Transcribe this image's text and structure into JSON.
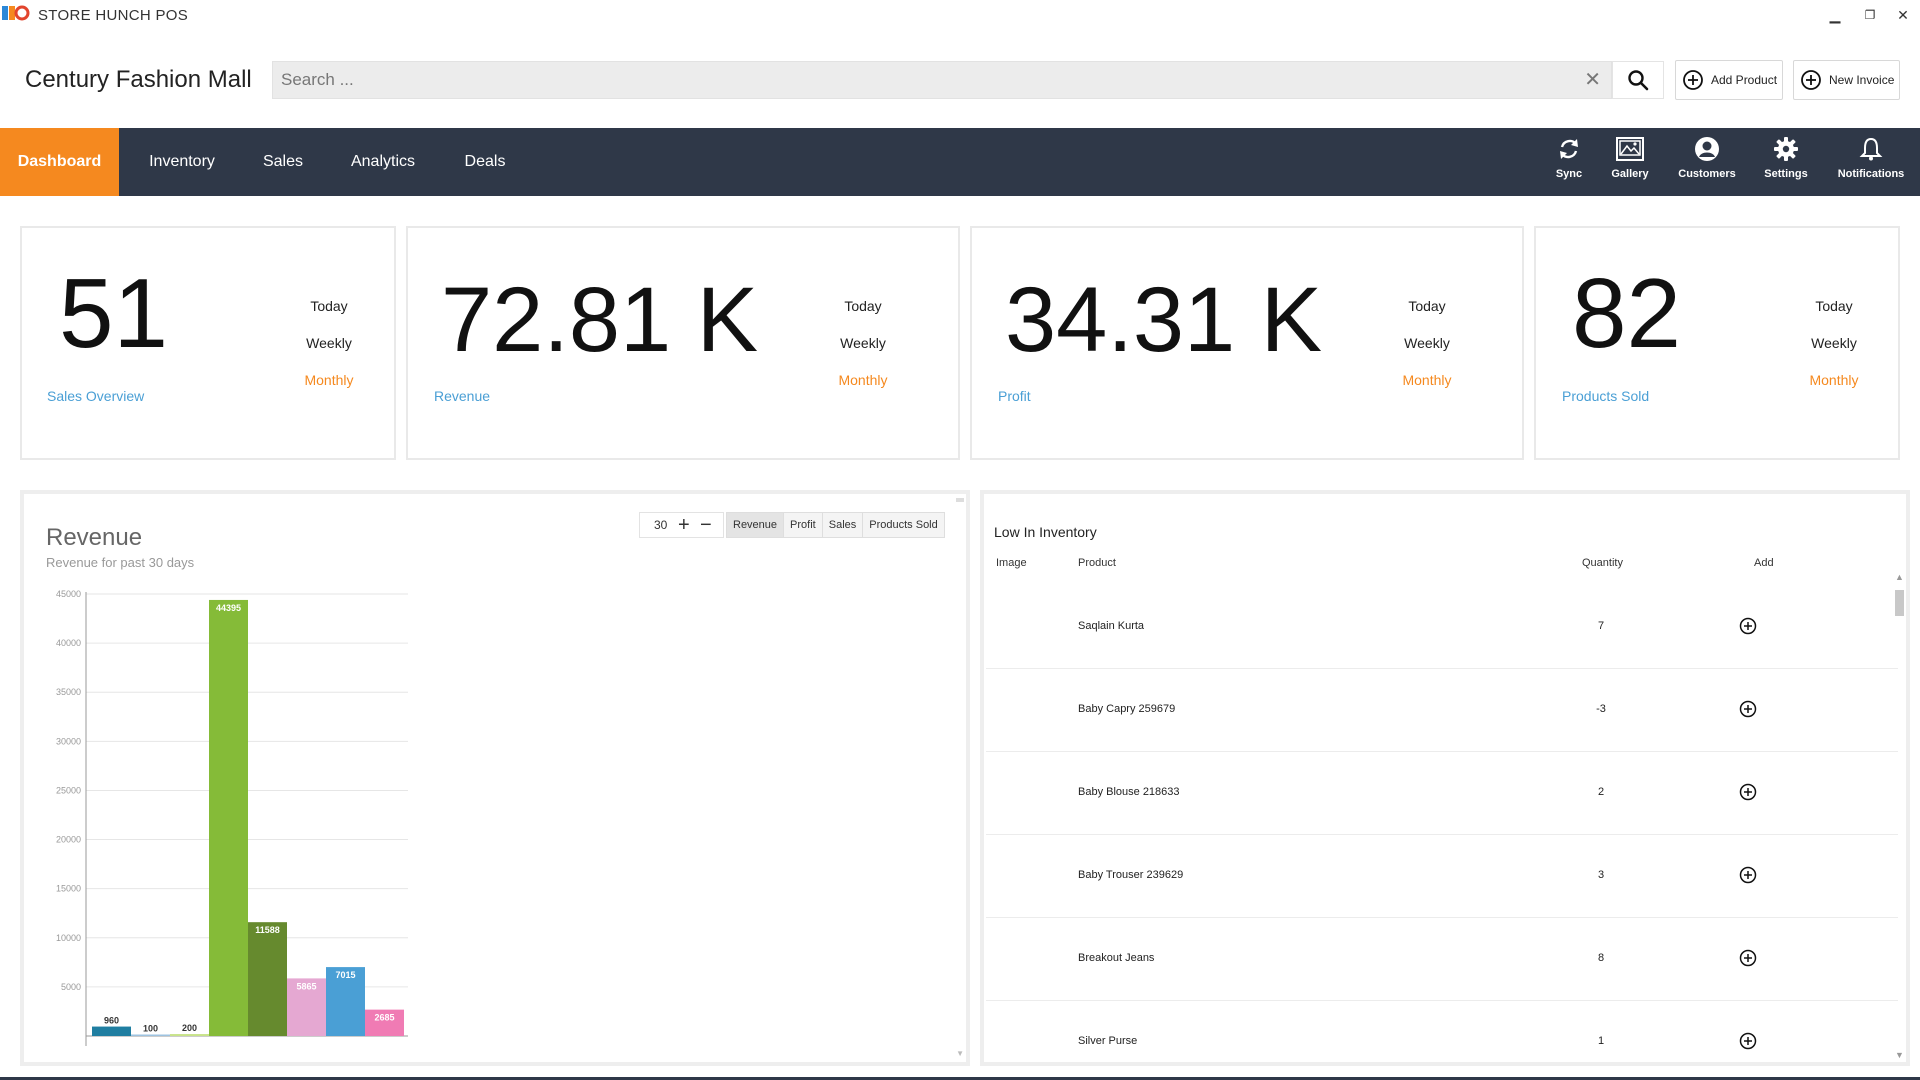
{
  "app": {
    "title": "STORE HUNCH POS"
  },
  "window_controls": {
    "minimize": "▁",
    "restore": "❐",
    "close": "✕"
  },
  "header": {
    "store_name": "Century Fashion Mall",
    "search_placeholder": "Search ...",
    "add_product": "Add Product",
    "new_invoice": "New Invoice"
  },
  "nav": {
    "tabs": [
      "Dashboard",
      "Inventory",
      "Sales",
      "Analytics",
      "Deals"
    ],
    "active": "Dashboard",
    "icons": [
      {
        "label": "Sync",
        "icon": "sync-icon"
      },
      {
        "label": "Gallery",
        "icon": "gallery-icon"
      },
      {
        "label": "Customers",
        "icon": "customers-icon"
      },
      {
        "label": "Settings",
        "icon": "gear-icon"
      },
      {
        "label": "Notifications",
        "icon": "bell-icon"
      }
    ]
  },
  "stats": [
    {
      "value": "51",
      "label": "Sales Overview",
      "periods": [
        "Today",
        "Weekly",
        "Monthly"
      ],
      "selected": "Monthly"
    },
    {
      "value": "72.81 K",
      "label": "Revenue",
      "periods": [
        "Today",
        "Weekly",
        "Monthly"
      ],
      "selected": "Monthly"
    },
    {
      "value": "34.31 K",
      "label": "Profit",
      "periods": [
        "Today",
        "Weekly",
        "Monthly"
      ],
      "selected": "Monthly"
    },
    {
      "value": "82",
      "label": "Products Sold",
      "periods": [
        "Today",
        "Weekly",
        "Monthly"
      ],
      "selected": "Monthly"
    }
  ],
  "revenue_panel": {
    "title": "Revenue",
    "subtitle": "Revenue for past 30 days",
    "days": "30",
    "metrics": [
      "Revenue",
      "Profit",
      "Sales",
      "Products Sold"
    ],
    "selected_metric": "Revenue"
  },
  "chart_data": {
    "type": "bar",
    "title": "Revenue",
    "subtitle": "Revenue for past 30 days",
    "values": [
      960,
      100,
      200,
      44395,
      11588,
      5865,
      7015,
      2685
    ],
    "colors": [
      "#1f7ea1",
      "#9ec3e0",
      "#c8e38a",
      "#85bb38",
      "#668a2e",
      "#e5a8d2",
      "#4a9fd5",
      "#f07bb4"
    ],
    "ylim": [
      0,
      45000
    ],
    "yticks": [
      5000,
      10000,
      15000,
      20000,
      25000,
      30000,
      35000,
      40000,
      45000
    ],
    "grid": true
  },
  "inventory": {
    "title": "Low In Inventory",
    "columns": [
      "Image",
      "Product",
      "Quantity",
      "Add"
    ],
    "rows": [
      {
        "product": "Saqlain Kurta",
        "quantity": "7"
      },
      {
        "product": "Baby Capry 259679",
        "quantity": "-3"
      },
      {
        "product": "Baby Blouse 218633",
        "quantity": "2"
      },
      {
        "product": "Baby Trouser 239629",
        "quantity": "3"
      },
      {
        "product": "Breakout Jeans",
        "quantity": "8"
      },
      {
        "product": "Silver Purse",
        "quantity": "1"
      }
    ]
  }
}
